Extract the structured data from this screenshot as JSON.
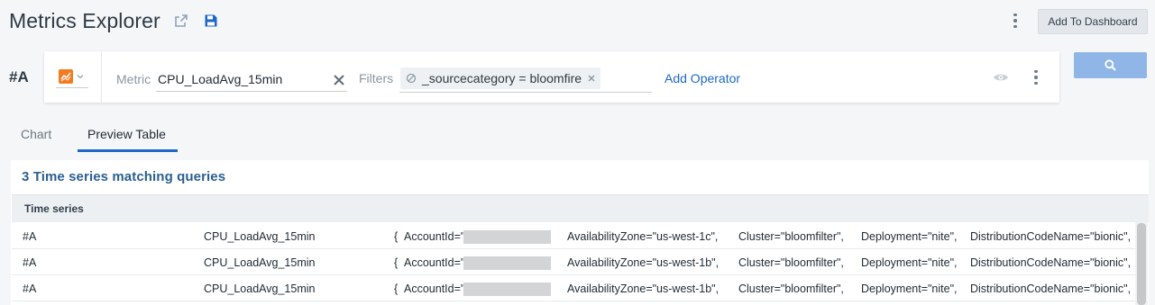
{
  "header": {
    "title": "Metrics Explorer",
    "add_to_dashboard_label": "Add To Dashboard"
  },
  "query": {
    "id": "#A",
    "metric_label": "Metric",
    "metric_value": "CPU_LoadAvg_15min",
    "filters_label": "Filters",
    "filter_chip": "_sourcecategory = bloomfire",
    "add_operator_label": "Add Operator",
    "chart_type_color": "#f47b20"
  },
  "tabs": [
    {
      "label": "Chart",
      "active": false
    },
    {
      "label": "Preview Table",
      "active": true
    }
  ],
  "table": {
    "match_text": "3 Time series matching queries",
    "column_header": "Time series",
    "rows": [
      {
        "query": "#A",
        "metric": "CPU_LoadAvg_15min",
        "brace": "{",
        "account": "AccountId=\"",
        "zone": "AvailabilityZone=\"us-west-1c\",",
        "cluster": "Cluster=\"bloomfilter\",",
        "deployment": "Deployment=\"nite\",",
        "distribution": "DistributionCodeName=\"bionic\","
      },
      {
        "query": "#A",
        "metric": "CPU_LoadAvg_15min",
        "brace": "{",
        "account": "AccountId=\"",
        "zone": "AvailabilityZone=\"us-west-1b\",",
        "cluster": "Cluster=\"bloomfilter\",",
        "deployment": "Deployment=\"nite\",",
        "distribution": "DistributionCodeName=\"bionic\","
      },
      {
        "query": "#A",
        "metric": "CPU_LoadAvg_15min",
        "brace": "{",
        "account": "AccountId=\"",
        "zone": "AvailabilityZone=\"us-west-1b\",",
        "cluster": "Cluster=\"bloomfilter\",",
        "deployment": "Deployment=\"nite\",",
        "distribution": "DistributionCodeName=\"bionic\","
      }
    ]
  },
  "colors": {
    "accent": "#1c67c8",
    "search_button": "#8fb6e6",
    "match_text": "#2a5f8f"
  },
  "icons": [
    "share-icon",
    "save-icon",
    "more-vertical-icon",
    "chart-type-icon",
    "chevron-down-icon",
    "clear-icon",
    "filter-exclude-icon",
    "remove-icon",
    "eye-icon",
    "search-icon"
  ]
}
